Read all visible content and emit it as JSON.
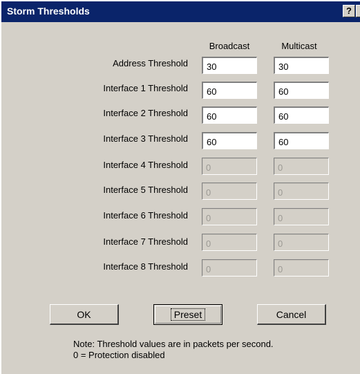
{
  "window": {
    "title": "Storm Thresholds",
    "help_glyph": "?",
    "close_glyph": "×"
  },
  "columns": {
    "broadcast": "Broadcast",
    "multicast": "Multicast"
  },
  "rows": [
    {
      "label": "Address Threshold",
      "broadcast": "30",
      "multicast": "30",
      "enabled": true
    },
    {
      "label": "Interface 1 Threshold",
      "broadcast": "60",
      "multicast": "60",
      "enabled": true
    },
    {
      "label": "Interface 2 Threshold",
      "broadcast": "60",
      "multicast": "60",
      "enabled": true
    },
    {
      "label": "Interface 3 Threshold",
      "broadcast": "60",
      "multicast": "60",
      "enabled": true
    },
    {
      "label": "Interface 4 Threshold",
      "broadcast": "0",
      "multicast": "0",
      "enabled": false
    },
    {
      "label": "Interface 5 Threshold",
      "broadcast": "0",
      "multicast": "0",
      "enabled": false
    },
    {
      "label": "Interface 6 Threshold",
      "broadcast": "0",
      "multicast": "0",
      "enabled": false
    },
    {
      "label": "Interface 7 Threshold",
      "broadcast": "0",
      "multicast": "0",
      "enabled": false
    },
    {
      "label": "Interface 8 Threshold",
      "broadcast": "0",
      "multicast": "0",
      "enabled": false
    }
  ],
  "buttons": {
    "ok": "OK",
    "preset": "Preset",
    "cancel": "Cancel"
  },
  "note": {
    "line1": "Note: Threshold values are in packets per second.",
    "line2": "0 = Protection disabled"
  },
  "colors": {
    "titlebar": "#0a246a",
    "dialog_bg": "#d4d0c8"
  }
}
